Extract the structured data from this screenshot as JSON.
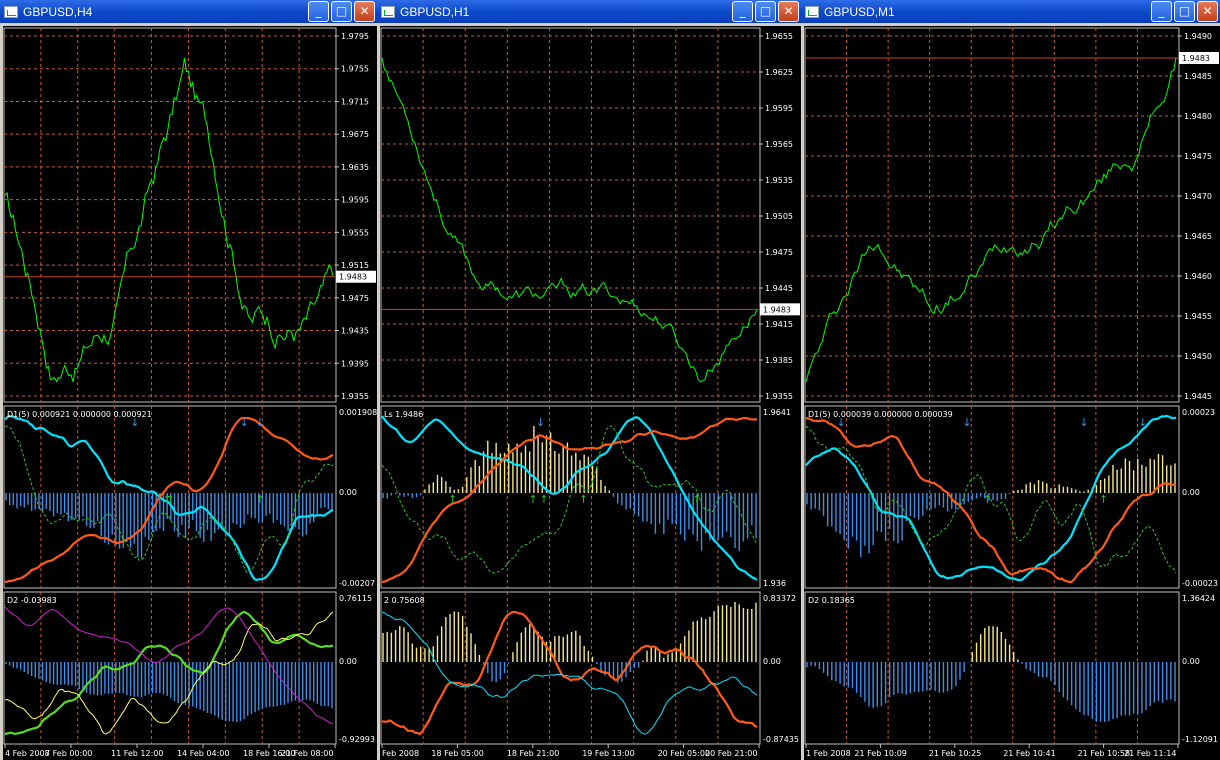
{
  "windows": [
    {
      "title": "GBPUSD,H4",
      "price_levels": [
        "1.9795",
        "1.9755",
        "1.9715",
        "1.9675",
        "1.9635",
        "1.9595",
        "1.9555",
        "1.9515",
        "1.9475",
        "1.9435",
        "1.9395",
        "1.9355"
      ],
      "current_price": "1.9483",
      "ind1_label": "D1(5) 0.000921 0.000000 0.000921",
      "ind1_levels": [
        "0.001908",
        "0.00",
        "-0.00207"
      ],
      "ind2_label": "D2 -0.03983",
      "ind2_levels": [
        "0.76115",
        "0.00",
        "-0.92993"
      ],
      "dates": [
        "4 Feb 2008",
        "7 Feb 00:00",
        "11 Feb 12:00",
        "14 Feb 04:00",
        "18 Feb 16:00",
        "21 Feb 08:00"
      ]
    },
    {
      "title": "GBPUSD,H1",
      "price_levels": [
        "1.9655",
        "1.9625",
        "1.9595",
        "1.9565",
        "1.9535",
        "1.9505",
        "1.9475",
        "1.9445",
        "1.9415",
        "1.9385",
        "1.9355"
      ],
      "current_price": "1.9483",
      "ind1_label": "Ls 1.9486",
      "ind1_levels": [
        "1.9641",
        "1.936"
      ],
      "ind2_label": "2 0.75608",
      "ind2_levels": [
        "0.83372",
        "0.00",
        "-0.87435"
      ],
      "dates": [
        "Feb 2008",
        "18 Feb 05:00",
        "18 Feb 21:00",
        "19 Feb 13:00",
        "20 Feb 05:00",
        "20 Feb 21:00"
      ]
    },
    {
      "title": "GBPUSD,M1",
      "price_levels": [
        "1.9490",
        "1.9485",
        "1.9480",
        "1.9475",
        "1.9470",
        "1.9465",
        "1.9460",
        "1.9455",
        "1.9450",
        "1.9445"
      ],
      "current_price": "1.9483",
      "ind1_label": "D1(5) 0.000039 0.000000 0.000039",
      "ind1_levels": [
        "0.00023",
        "0.00",
        "-0.00023"
      ],
      "ind2_label": "D2 0.18365",
      "ind2_levels": [
        "1.36424",
        "0.00",
        "-1.12091"
      ],
      "dates": [
        "1 Feb 2008",
        "21 Feb 10:09",
        "21 Feb 10:25",
        "21 Feb 10:41",
        "21 Feb 10:58",
        "21 Feb 11:14"
      ]
    }
  ],
  "buttons": {
    "minimize": "_",
    "maximize": "□",
    "close": "✕"
  },
  "icons": {
    "window": "chart-window-icon"
  },
  "colors": {
    "bg": "#000000",
    "price_line": "#00ff00",
    "grid": "#c0603a",
    "cyan": "#00e5ff",
    "orange": "#ff5a1a",
    "hist_up": "#f5e88a",
    "hist_down": "#3b8fe8",
    "current": "#c8442a"
  }
}
